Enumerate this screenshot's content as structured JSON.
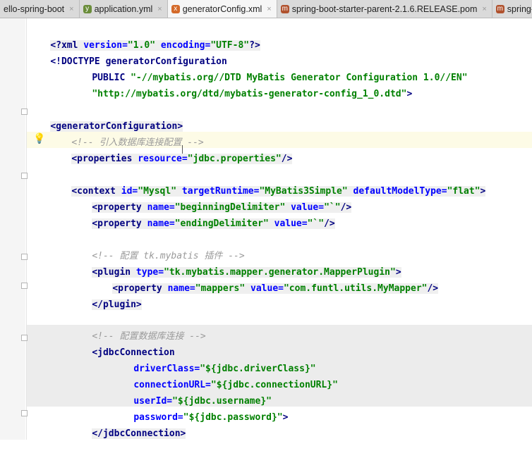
{
  "tabs": [
    {
      "label": "ello-spring-boot",
      "icon": "",
      "active": false
    },
    {
      "label": "application.yml",
      "icon": "yml-file-icon",
      "active": false
    },
    {
      "label": "generatorConfig.xml",
      "icon": "xml-file-icon",
      "active": true
    },
    {
      "label": "spring-boot-starter-parent-2.1.6.RELEASE.pom",
      "icon": "maven-file-icon",
      "active": false
    },
    {
      "label": "spring-bo",
      "icon": "maven-file-icon",
      "active": false
    }
  ],
  "tab_close": "×",
  "code": {
    "l1_open": "<?",
    "l1_tag": "xml",
    "l1_a1": " version=",
    "l1_v1": "\"1.0\"",
    "l1_a2": " encoding=",
    "l1_v2": "\"UTF-8\"",
    "l1_close": "?>",
    "l2": "<!DOCTYPE generatorConfiguration",
    "l3_kw": "PUBLIC ",
    "l3_v": "\"-//mybatis.org//DTD MyBatis Generator Configuration 1.0//EN\"",
    "l4_v": "\"http://mybatis.org/dtd/mybatis-generator-config_1_0.dtd\"",
    "l4_close": ">",
    "l6_tag": "<generatorConfiguration>",
    "l7_com": "<!-- 引入数据库连接配置 -->",
    "l8_tag": "<properties",
    "l8_a": " resource=",
    "l8_v": "\"jdbc.properties\"",
    "l8_close": "/>",
    "l10_tag": "<context",
    "l10_a1": " id=",
    "l10_v1": "\"Mysql\"",
    "l10_a2": " targetRuntime=",
    "l10_v2": "\"MyBatis3Simple\"",
    "l10_a3": " defaultModelType=",
    "l10_v3": "\"flat\"",
    "l10_close": ">",
    "l11_tag": "<property",
    "l11_a1": " name=",
    "l11_v1": "\"beginningDelimiter\"",
    "l11_a2": " value=",
    "l11_v2": "\"`\"",
    "l11_close": "/>",
    "l12_tag": "<property",
    "l12_a1": " name=",
    "l12_v1": "\"endingDelimiter\"",
    "l12_a2": " value=",
    "l12_v2": "\"`\"",
    "l12_close": "/>",
    "l14_com": "<!-- 配置 tk.mybatis 插件 -->",
    "l15_tag": "<plugin",
    "l15_a": " type=",
    "l15_v": "\"tk.mybatis.mapper.generator.MapperPlugin\"",
    "l15_close": ">",
    "l16_tag": "<property",
    "l16_a1": " name=",
    "l16_v1": "\"mappers\"",
    "l16_a2": " value=",
    "l16_v2": "\"com.funtl.utils.MyMapper\"",
    "l16_close": "/>",
    "l17_tag": "</plugin>",
    "l19_com": "<!-- 配置数据库连接 -->",
    "l20_tag": "<jdbcConnection",
    "l21_a": "driverClass=",
    "l21_v": "\"${jdbc.driverClass}\"",
    "l22_a": "connectionURL=",
    "l22_v": "\"${jdbc.connectionURL}\"",
    "l23_a": "userId=",
    "l23_v": "\"${jdbc.username}\"",
    "l24_a": "password=",
    "l24_v": "\"${jdbc.password}\"",
    "l24_close": ">",
    "l25_tag": "</jdbcConnection>"
  }
}
